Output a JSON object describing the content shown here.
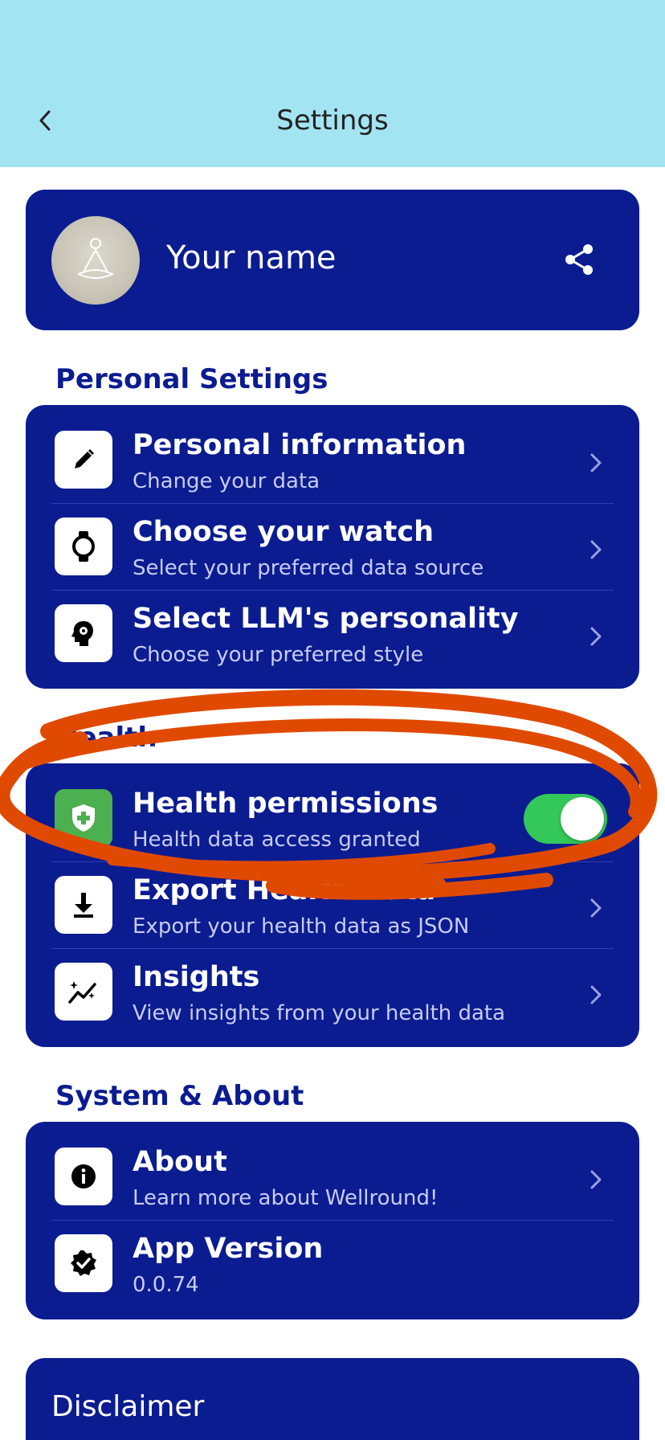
{
  "header": {
    "title": "Settings"
  },
  "profile": {
    "name": "Your name"
  },
  "sections": {
    "personal": {
      "title": "Personal Settings",
      "items": [
        {
          "title": "Personal information",
          "subtitle": "Change your data"
        },
        {
          "title": "Choose your watch",
          "subtitle": "Select your preferred data source"
        },
        {
          "title": "Select LLM's personality",
          "subtitle": "Choose your preferred style"
        }
      ]
    },
    "health": {
      "title": "Health",
      "items": [
        {
          "title": "Health permissions",
          "subtitle": "Health data access granted",
          "toggle_on": true
        },
        {
          "title": "Export Health Data",
          "subtitle": "Export your health data as JSON"
        },
        {
          "title": "Insights",
          "subtitle": "View insights from your health data"
        }
      ]
    },
    "system": {
      "title": "System & About",
      "items": [
        {
          "title": "About",
          "subtitle": "Learn more about Wellround!"
        },
        {
          "title": "App Version",
          "subtitle": "0.0.74"
        }
      ]
    }
  },
  "disclaimer": {
    "title": "Disclaimer"
  },
  "icons": {
    "back": "chevron-left-icon",
    "share": "share-icon",
    "personal_information": "pencil-icon",
    "watch": "watch-icon",
    "personality": "head-gear-icon",
    "health_permissions": "shield-plus-icon",
    "export": "download-icon",
    "insights": "sparkle-chart-icon",
    "about": "info-icon",
    "version": "verified-badge-icon"
  },
  "colors": {
    "header_bg": "#a3e4f2",
    "card_bg": "#0b1c91",
    "toggle_on": "#34c759",
    "annotation": "#e04a00"
  }
}
